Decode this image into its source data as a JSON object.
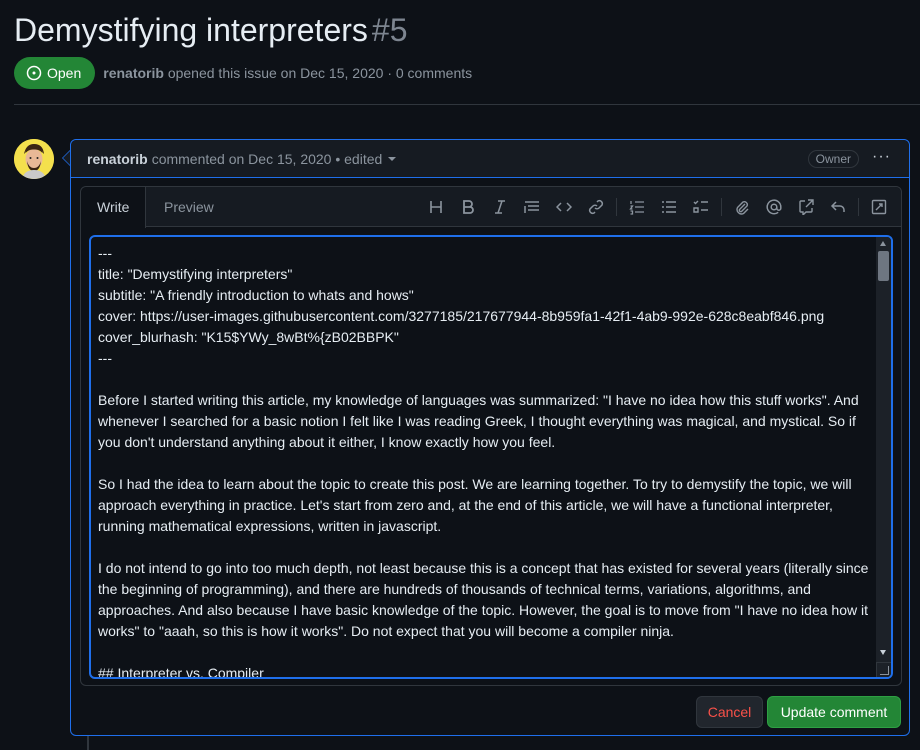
{
  "issue": {
    "title": "Demystifying interpreters",
    "number": "#5",
    "state": "Open",
    "author": "renatorib",
    "meta_suffix": "opened this issue on Dec 15, 2020 · 0 comments"
  },
  "comment": {
    "author": "renatorib",
    "header_text": "commented on Dec 15, 2020 • edited",
    "owner_badge": "Owner",
    "menu_glyph": "···"
  },
  "editor": {
    "tabs": [
      {
        "label": "Write",
        "active": true
      },
      {
        "label": "Preview",
        "active": false
      }
    ],
    "toolbar_icons": [
      "heading-icon",
      "bold-icon",
      "italic-icon",
      "quote-icon",
      "code-icon",
      "link-icon",
      "ordered-list-icon",
      "unordered-list-icon",
      "task-list-icon",
      "attach-icon",
      "mention-icon",
      "cross-reference-icon",
      "reply-icon",
      "fullscreen-icon"
    ],
    "content": "---\ntitle: \"Demystifying interpreters\"\nsubtitle: \"A friendly introduction to whats and hows\"\ncover: https://user-images.githubusercontent.com/3277185/217677944-8b959fa1-42f1-4ab9-992e-628c8eabf846.png\ncover_blurhash: \"K15$YWy_8wBt%{zB02BBPK\"\n---\n\nBefore I started writing this article, my knowledge of languages was summarized: \"I have no idea how this stuff works\". And whenever I searched for a basic notion I felt like I was reading Greek, I thought everything was magical, and mystical. So if you don't understand anything about it either, I know exactly how you feel.\n\nSo I had the idea to learn about the topic to create this post. We are learning together. To try to demystify the topic, we will approach everything in practice. Let's start from zero and, at the end of this article, we will have a functional interpreter, running mathematical expressions, written in javascript.\n\nI do not intend to go into too much depth, not least because this is a concept that has existed for several years (literally since the beginning of programming), and there are hundreds of thousands of technical terms, variations, algorithms, and approaches. And also because I have basic knowledge of the topic. However, the goal is to move from \"I have no idea how it works\" to \"aaah, so this is how it works\". Do not expect that you will become a compiler ninja.\n\n## Interpreter vs. Compiler"
  },
  "actions": {
    "cancel": "Cancel",
    "update": "Update comment"
  },
  "colors": {
    "accent": "#1f6feb",
    "success": "#238636",
    "danger": "#f85149",
    "background": "#0d1117"
  }
}
